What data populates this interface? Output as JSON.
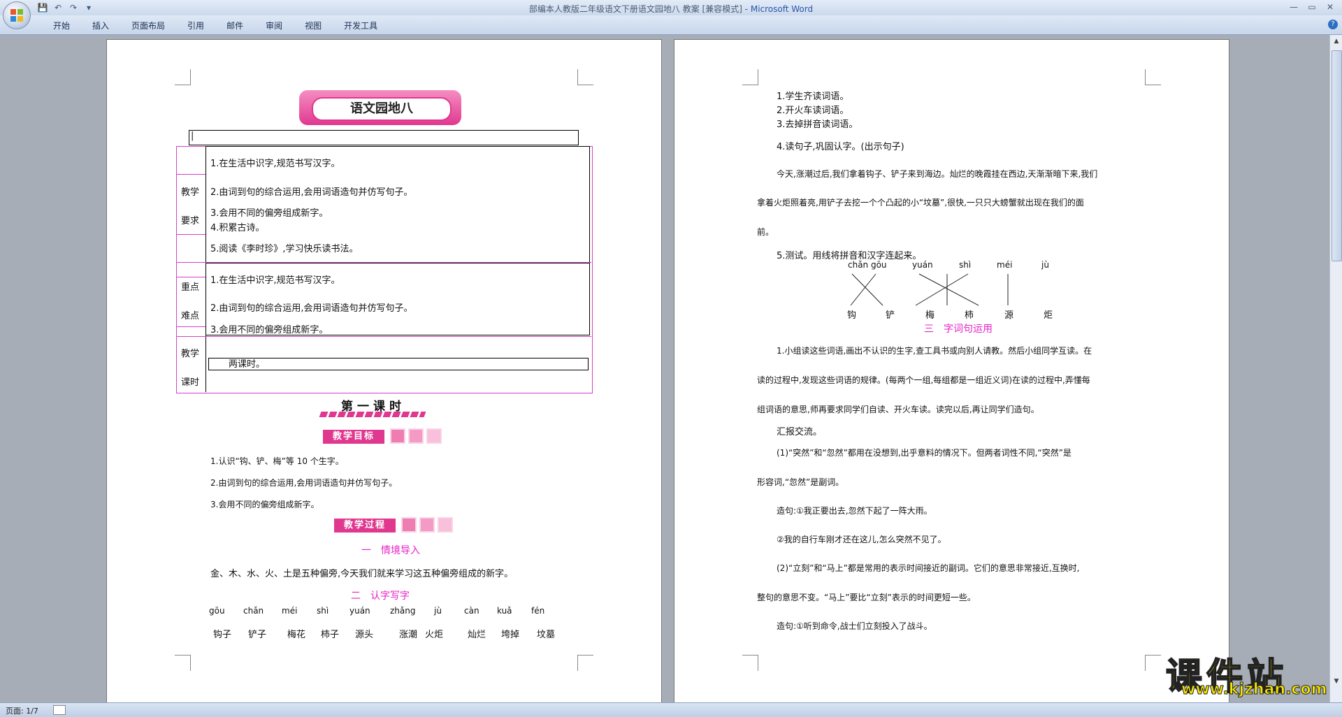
{
  "window": {
    "title_doc": "部编本人教版二年级语文下册语文园地八 教案 [兼容模式] - ",
    "title_app": "Microsoft Word",
    "min": "—",
    "max": "▭",
    "close": "✕"
  },
  "qat": {
    "save": "💾",
    "undo": "↶",
    "redo": "↷",
    "more": "▾"
  },
  "ribbon": {
    "tabs": [
      "开始",
      "插入",
      "页面布局",
      "引用",
      "邮件",
      "审阅",
      "视图",
      "开发工具"
    ],
    "help": "?"
  },
  "status": {
    "page": "页面: 1/7"
  },
  "brand": {
    "name": "课件站",
    "url": "www.kjzhan.com"
  },
  "page1": {
    "banner_title": "语文园地八",
    "cursor": "|",
    "table": {
      "r1_label_a": "教学",
      "r1_label_b": "要求",
      "r1_items": [
        "1.在生活中识字,规范书写汉字。",
        "2.由词到句的综合运用,会用词语造句并仿写句子。",
        "3.会用不同的偏旁组成新字。",
        "4.积累古诗。",
        "5.阅读《李时珍》,学习快乐读书法。"
      ],
      "r2_label_a": "重点",
      "r2_label_b": "难点",
      "r2_items": [
        "1.在生活中识字,规范书写汉字。",
        "2.由词到句的综合运用,会用词语造句并仿写句子。",
        "3.会用不同的偏旁组成新字。"
      ],
      "r3_label_a": "教学",
      "r3_label_b": "课时",
      "r3_value": "两课时。"
    },
    "lesson_title": "第一课时",
    "goal_label": "教学目标",
    "goals": [
      "1.认识“钩、铲、梅”等 10 个生字。",
      "2.由词到句的综合运用,会用词语造句并仿写句子。",
      "3.会用不同的偏旁组成新字。"
    ],
    "process_label": "教学过程",
    "sec1": "一　情境导入",
    "sec1_text": "金、木、水、火、土是五种偏旁,今天我们就来学习这五种偏旁组成的新字。",
    "sec2": "二　认字写字",
    "pinyin": [
      "gōu",
      "chǎn",
      "méi",
      "shì",
      "yuán",
      "zhǎng",
      "jù",
      "càn",
      "kuǎ",
      "fén"
    ],
    "words": [
      "钩子",
      "铲子",
      "梅花",
      "柿子",
      "源头",
      "涨潮",
      "火炬",
      "灿烂",
      "垮掉",
      "坟墓"
    ]
  },
  "page2": {
    "lines1": [
      "1.学生齐读词语。",
      "2.开火车读词语。",
      "3.去掉拼音读词语。"
    ],
    "item4": "4.读句子,巩固认字。(出示句子)",
    "para1": [
      "今天,涨潮过后,我们拿着钩子、铲子来到海边。灿烂的晚霞挂在西边,天渐渐暗下来,我们",
      "拿着火炬照着亮,用铲子去挖一个个凸起的小“坟墓”,很快,一只只大螃蟹就出现在我们的面",
      "前。"
    ],
    "item5": "5.测试。用线将拼音和汉字连起来。",
    "match_pinyin": [
      "chǎn gōu",
      "yuán",
      "shì",
      "méi",
      "jù"
    ],
    "match_chars": [
      "钩",
      "铲",
      "梅",
      "柿",
      "源",
      "炬"
    ],
    "sec3": "三　字词句运用",
    "para2": [
      "1.小组读这些词语,画出不认识的生字,查工具书或向别人请教。然后小组同学互读。在",
      "读的过程中,发现这些词语的规律。(每两个一组,每组都是一组近义词)在读的过程中,弄懂每",
      "组词语的意思,师再要求同学们自读、开火车读。读完以后,再让同学们造句。"
    ],
    "report": "汇报交流。",
    "p3": [
      "(1)“突然”和“忽然”都用在没想到,出乎意料的情况下。但两者词性不同,“突然”是",
      "形容词,“忽然”是副词。"
    ],
    "s1": "造句:①我正要出去,忽然下起了一阵大雨。",
    "s2": "②我的自行车刚才还在这儿,怎么突然不见了。",
    "p4": [
      "(2)“立刻”和“马上”都是常用的表示时间接近的副词。它们的意思非常接近,互换时,",
      "整句的意思不变。“马上”要比“立刻”表示的时间更短一些。"
    ],
    "s3": "造句:①听到命令,战士们立刻投入了战斗。"
  }
}
